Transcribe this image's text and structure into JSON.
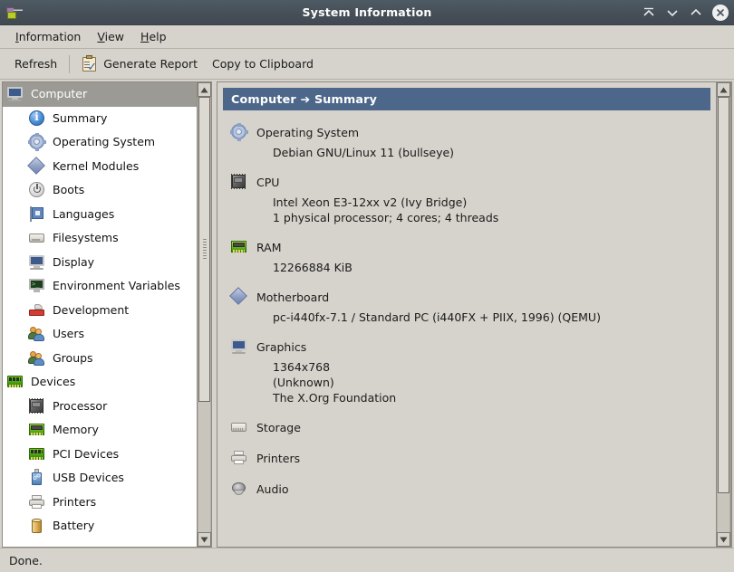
{
  "window": {
    "title": "System Information",
    "app_icon": "system-information-icon",
    "controls": [
      {
        "name": "shade-button",
        "glyph": "shade"
      },
      {
        "name": "minimize-button",
        "glyph": "chevron-down"
      },
      {
        "name": "maximize-button",
        "glyph": "chevron-up"
      },
      {
        "name": "close-button",
        "glyph": "x"
      }
    ]
  },
  "menubar": {
    "items": [
      {
        "label": "Information",
        "mnemonic": "I"
      },
      {
        "label": "View",
        "mnemonic": "V"
      },
      {
        "label": "Help",
        "mnemonic": "H"
      }
    ]
  },
  "toolbar": {
    "refresh_label": "Refresh",
    "generate_report_label": "Generate Report",
    "copy_to_clipboard_label": "Copy to Clipboard",
    "report_icon": "clipboard-check-icon"
  },
  "sidebar": {
    "items": [
      {
        "label": "Computer",
        "icon": "monitor-icon",
        "level": 0,
        "selected": true
      },
      {
        "label": "Summary",
        "icon": "info-icon",
        "level": 1,
        "selected": false
      },
      {
        "label": "Operating System",
        "icon": "gear-icon",
        "level": 1,
        "selected": false
      },
      {
        "label": "Kernel Modules",
        "icon": "diamond-icon",
        "level": 1,
        "selected": false
      },
      {
        "label": "Boots",
        "icon": "power-icon",
        "level": 1,
        "selected": false
      },
      {
        "label": "Languages",
        "icon": "flag-icon",
        "level": 1,
        "selected": false
      },
      {
        "label": "Filesystems",
        "icon": "drive-icon",
        "level": 1,
        "selected": false
      },
      {
        "label": "Display",
        "icon": "monitor-icon",
        "level": 1,
        "selected": false
      },
      {
        "label": "Environment Variables",
        "icon": "terminal-icon",
        "level": 1,
        "selected": false
      },
      {
        "label": "Development",
        "icon": "tool-icon",
        "level": 1,
        "selected": false
      },
      {
        "label": "Users",
        "icon": "users-icon",
        "level": 1,
        "selected": false
      },
      {
        "label": "Groups",
        "icon": "users-icon",
        "level": 1,
        "selected": false
      },
      {
        "label": "Devices",
        "icon": "circuit-board-icon",
        "level": 0,
        "selected": false
      },
      {
        "label": "Processor",
        "icon": "cpu-icon",
        "level": 1,
        "selected": false
      },
      {
        "label": "Memory",
        "icon": "ram-icon",
        "level": 1,
        "selected": false
      },
      {
        "label": "PCI Devices",
        "icon": "circuit-board-icon",
        "level": 1,
        "selected": false
      },
      {
        "label": "USB Devices",
        "icon": "usb-icon",
        "level": 1,
        "selected": false
      },
      {
        "label": "Printers",
        "icon": "printer-icon",
        "level": 1,
        "selected": false
      },
      {
        "label": "Battery",
        "icon": "battery-icon",
        "level": 1,
        "selected": false
      }
    ]
  },
  "content": {
    "header": "Computer ➔ Summary",
    "sections": [
      {
        "title": "Operating System",
        "icon": "gear-icon",
        "lines": [
          "Debian GNU/Linux 11 (bullseye)"
        ]
      },
      {
        "title": "CPU",
        "icon": "cpu-icon",
        "lines": [
          "Intel Xeon E3-12xx v2 (Ivy Bridge)",
          "1 physical processor; 4 cores; 4 threads"
        ]
      },
      {
        "title": "RAM",
        "icon": "ram-icon",
        "lines": [
          "12266884 KiB"
        ]
      },
      {
        "title": "Motherboard",
        "icon": "diamond-icon",
        "lines": [
          "pc-i440fx-7.1 / Standard PC (i440FX + PIIX, 1996) (QEMU)"
        ]
      },
      {
        "title": "Graphics",
        "icon": "monitor-icon",
        "lines": [
          "1364x768",
          "(Unknown)",
          "The X.Org Foundation"
        ]
      },
      {
        "title": "Storage",
        "icon": "hdd-icon",
        "lines": []
      },
      {
        "title": "Printers",
        "icon": "printer-icon",
        "lines": []
      },
      {
        "title": "Audio",
        "icon": "speaker-icon",
        "lines": []
      }
    ]
  },
  "statusbar": {
    "text": "Done."
  },
  "colors": {
    "titlebar": "#464f57",
    "header_accent": "#4d678a",
    "window_bg": "#d6d3cc",
    "selection": "#9b9a94",
    "tree_bg": "#ffffff"
  },
  "scrollbars": {
    "sidebar": {
      "thumb_top_pct": 0,
      "thumb_height_pct": 70
    },
    "content": {
      "thumb_top_pct": 0,
      "thumb_height_pct": 91
    }
  }
}
